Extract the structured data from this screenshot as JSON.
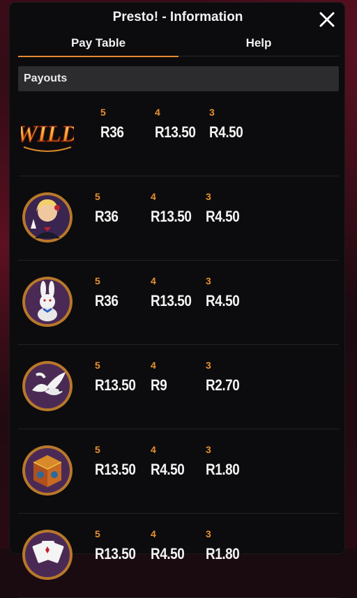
{
  "header": {
    "title": "Presto! - Information"
  },
  "tabs": [
    {
      "label": "Pay Table",
      "active": true
    },
    {
      "label": "Help",
      "active": false
    }
  ],
  "section": {
    "title": "Payouts"
  },
  "rows": [
    {
      "symbol_icon": "wild-logo",
      "wild_text": "WILD",
      "counts": [
        "5",
        "4",
        "3"
      ],
      "values": [
        "R36",
        "R13.50",
        "R4.50"
      ]
    },
    {
      "symbol_icon": "magician-assistant-portrait",
      "counts": [
        "5",
        "4",
        "3"
      ],
      "values": [
        "R36",
        "R13.50",
        "R4.50"
      ]
    },
    {
      "symbol_icon": "white-rabbit",
      "counts": [
        "5",
        "4",
        "3"
      ],
      "values": [
        "R36",
        "R13.50",
        "R4.50"
      ]
    },
    {
      "symbol_icon": "white-doves",
      "counts": [
        "5",
        "4",
        "3"
      ],
      "values": [
        "R13.50",
        "R9",
        "R2.70"
      ]
    },
    {
      "symbol_icon": "magic-box",
      "counts": [
        "5",
        "4",
        "3"
      ],
      "values": [
        "R13.50",
        "R4.50",
        "R1.80"
      ]
    },
    {
      "symbol_icon": "playing-cards",
      "counts": [
        "5",
        "4",
        "3"
      ],
      "values": [
        "R13.50",
        "R4.50",
        "R1.80"
      ]
    }
  ],
  "colors": {
    "accent": "#e38a2e",
    "panel": "#0c0b0d",
    "header_bar": "#2c2c2e"
  }
}
